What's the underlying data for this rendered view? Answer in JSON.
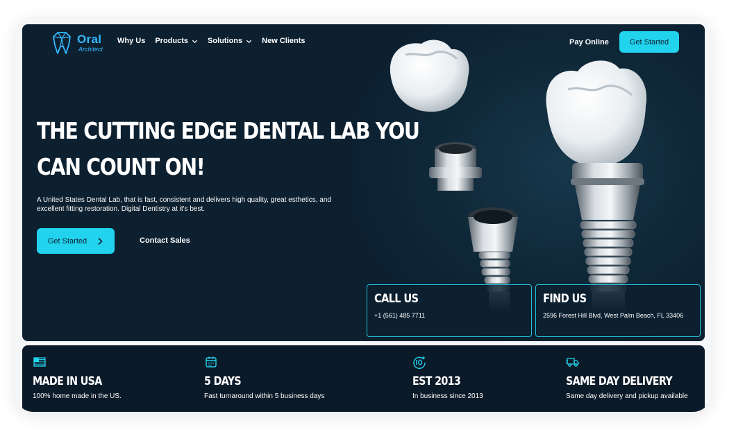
{
  "logo": {
    "name": "Oral",
    "sub": "Architect"
  },
  "nav": {
    "items": [
      {
        "label": "Why Us",
        "dropdown": false
      },
      {
        "label": "Products",
        "dropdown": true
      },
      {
        "label": "Solutions",
        "dropdown": true
      },
      {
        "label": "New Clients",
        "dropdown": false
      }
    ],
    "pay_online": "Pay Online",
    "cta": "Get Started"
  },
  "hero": {
    "headline_line1": "THE CUTTING EDGE DENTAL LAB YOU",
    "headline_line2": "CAN COUNT ON!",
    "subtext": "A United States Dental Lab, that is fast, consistent and delivers high quality, great esthetics, and excellent fitting restoration. Digital Dentistry at it's best.",
    "primary_button": "Get Started",
    "secondary_button": "Contact Sales"
  },
  "cards": {
    "call": {
      "title": "CALL US",
      "text": "+1 (561) 485 7711"
    },
    "find": {
      "title": "FIND US",
      "text": "2596 Forest Hill Blvd, West Palm Beach, FL 33406"
    }
  },
  "features": [
    {
      "icon": "flag-icon",
      "title": "MADE IN USA",
      "text": "100% home made in the US."
    },
    {
      "icon": "calendar-icon",
      "title": "5 DAYS",
      "text": "Fast turnaround within 5 business days"
    },
    {
      "icon": "ten-years-icon",
      "title": "EST 2013",
      "text": "In business since 2013"
    },
    {
      "icon": "delivery-truck-icon",
      "title": "SAME DAY DELIVERY",
      "text": "Same day delivery and pickup available"
    }
  ],
  "colors": {
    "accent": "#22d3ee",
    "background": "#0c2030",
    "logo": "#36b9ff",
    "strip": "#0b1a28"
  }
}
